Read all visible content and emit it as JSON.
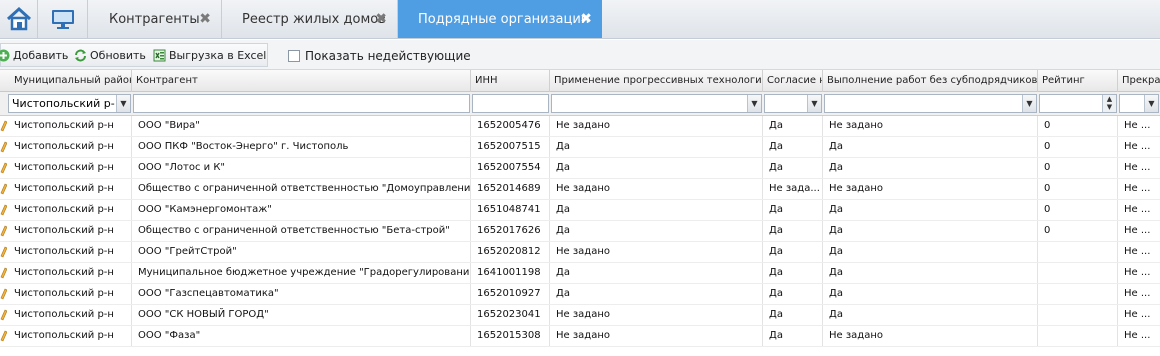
{
  "tabs": [
    {
      "label": "Контрагенты",
      "active": false
    },
    {
      "label": "Реестр жилых домов",
      "active": false
    },
    {
      "label": "Подрядные организации",
      "active": true
    }
  ],
  "toolbar": {
    "add_label": "Добавить",
    "refresh_label": "Обновить",
    "export_label": "Выгрузка в Excel",
    "show_inactive_label": "Показать недействующие"
  },
  "columns": [
    "Муниципальный район",
    "Контрагент",
    "ИНН",
    "Применение прогрессивных технологий",
    "Согласие н",
    "Выполнение работ без субподрядчиков",
    "Рейтинг",
    "Прекра"
  ],
  "filters": {
    "municipal": "Чистопольский р-"
  },
  "rows": [
    [
      "Чистопольский р-н",
      "ООО \"Вира\"",
      "1652005476",
      "Не задано",
      "Да",
      "Не задано",
      "0",
      "Не ..."
    ],
    [
      "Чистопольский р-н",
      "ООО ПКФ \"Восток-Энерго\" г. Чистополь",
      "1652007515",
      "Да",
      "Да",
      "Да",
      "0",
      "Не ..."
    ],
    [
      "Чистопольский р-н",
      "ООО \"Лотос и К\"",
      "1652007554",
      "Да",
      "Да",
      "Да",
      "0",
      "Не ..."
    ],
    [
      "Чистопольский р-н",
      "Общество с ограниченной ответственностью \"Домоуправлени...",
      "1652014689",
      "Не задано",
      "Не зада...",
      "Не задано",
      "0",
      "Не ..."
    ],
    [
      "Чистопольский р-н",
      "ООО \"Камэнергомонтаж\"",
      "1651048741",
      "Да",
      "Да",
      "Да",
      "0",
      "Не ..."
    ],
    [
      "Чистопольский р-н",
      "Общество с ограниченной ответственностью \"Бета-строй\"",
      "1652017626",
      "Да",
      "Да",
      "Да",
      "0",
      "Не ..."
    ],
    [
      "Чистопольский р-н",
      "ООО \"ГрейтСтрой\"",
      "1652020812",
      "Не задано",
      "Да",
      "Да",
      "",
      "Не ..."
    ],
    [
      "Чистопольский р-н",
      "Муниципальное бюджетное учреждение \"Градорегулировани...",
      "1641001198",
      "Да",
      "Да",
      "Да",
      "",
      "Не ..."
    ],
    [
      "Чистопольский р-н",
      "ООО \"Газспецавтоматика\"",
      "1652010927",
      "Да",
      "Да",
      "Да",
      "",
      "Не ..."
    ],
    [
      "Чистопольский р-н",
      "ООО \"СК НОВЫЙ ГОРОД\"",
      "1652023041",
      "Не задано",
      "Да",
      "Да",
      "",
      "Не ..."
    ],
    [
      "Чистопольский р-н",
      "ООО \"Фаза\"",
      "1652015308",
      "Не задано",
      "Да",
      "Не задано",
      "",
      "Не ..."
    ]
  ],
  "colors": {
    "active_tab": "#4f9de3",
    "toolbar_bg": "#f3f4f6",
    "header_bg": "#e8e8e8"
  },
  "icons": [
    "home-icon",
    "desktop-icon",
    "close-icon",
    "add-icon",
    "refresh-icon",
    "excel-icon",
    "chevron-down-icon",
    "spinner-icon",
    "pencil-icon"
  ]
}
